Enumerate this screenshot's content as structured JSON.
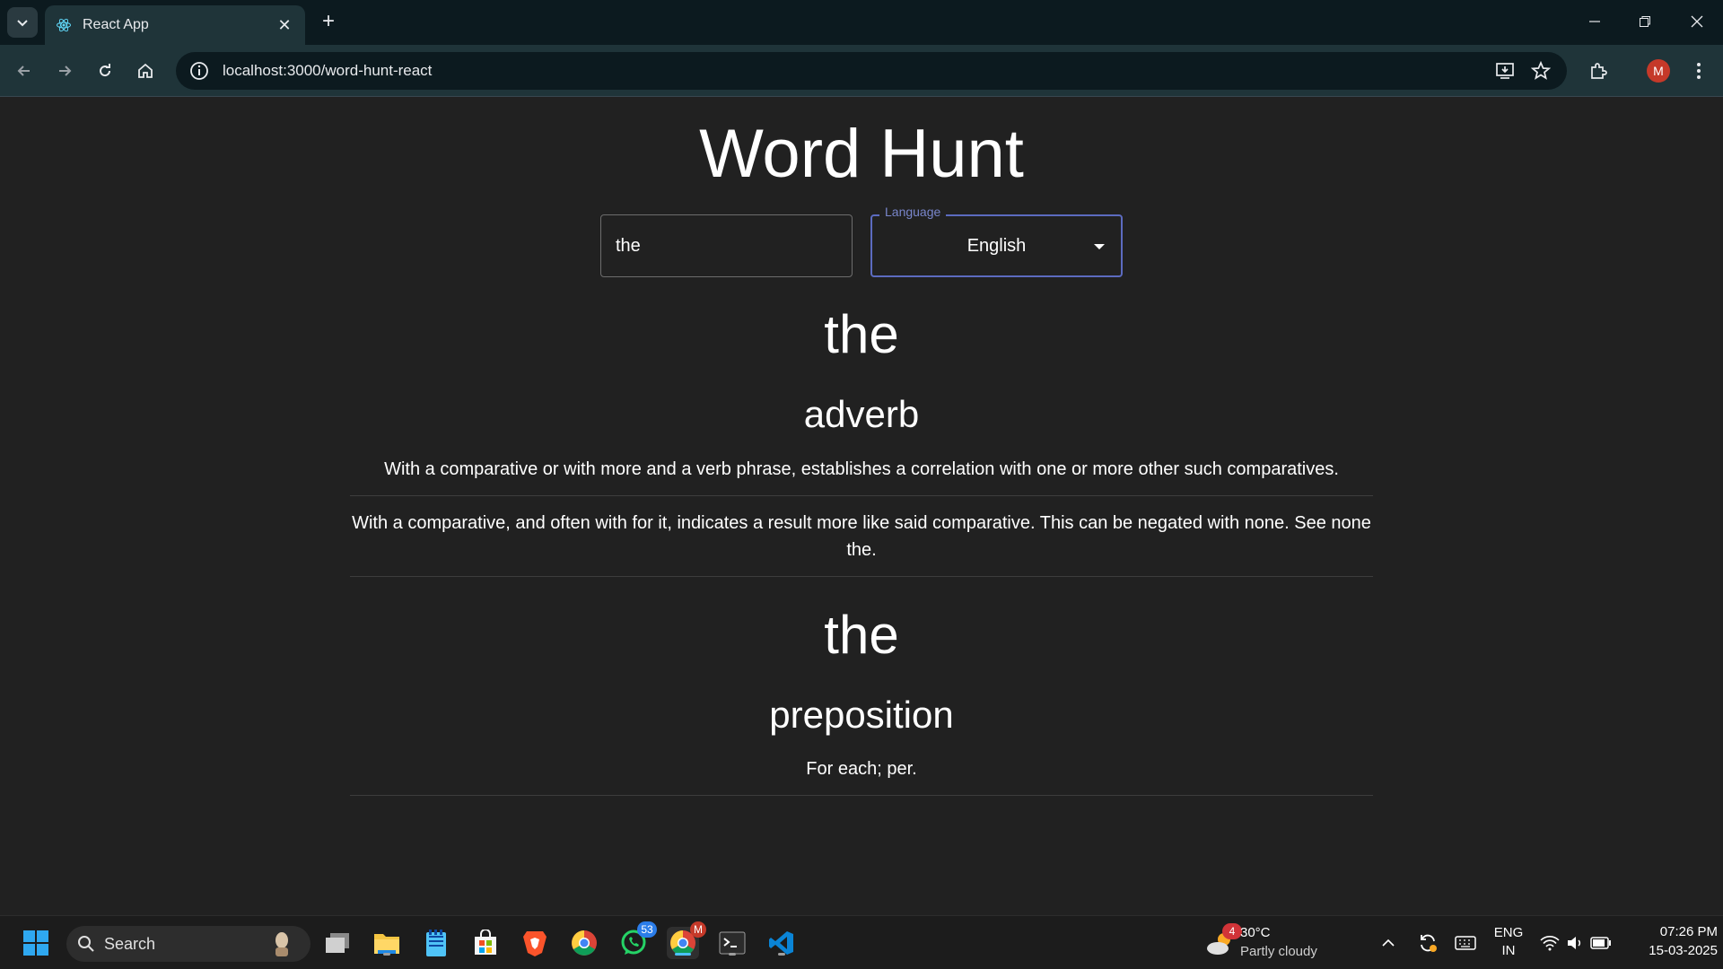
{
  "browser": {
    "tab_title": "React App",
    "url": "localhost:3000/word-hunt-react",
    "profile_initial": "M"
  },
  "app": {
    "title": "Word Hunt",
    "search_value": "the",
    "language_label": "Language",
    "language_value": "English"
  },
  "entries": [
    {
      "word": "the",
      "part_of_speech": "adverb",
      "definitions": [
        "With a comparative or with more and a verb phrase, establishes a correlation with one or more other such comparatives.",
        "With a comparative, and often with for it, indicates a result more like said comparative. This can be negated with none. See none the."
      ]
    },
    {
      "word": "the",
      "part_of_speech": "preposition",
      "definitions": [
        "For each; per."
      ]
    }
  ],
  "taskbar": {
    "search_label": "Search",
    "whatsapp_badge": "53",
    "weather_badge": "4",
    "weather_temp": "30°C",
    "weather_desc": "Partly cloudy",
    "lang_top": "ENG",
    "lang_bottom": "IN",
    "time": "07:26 PM",
    "date": "15-03-2025",
    "chrome_badge": "M"
  }
}
